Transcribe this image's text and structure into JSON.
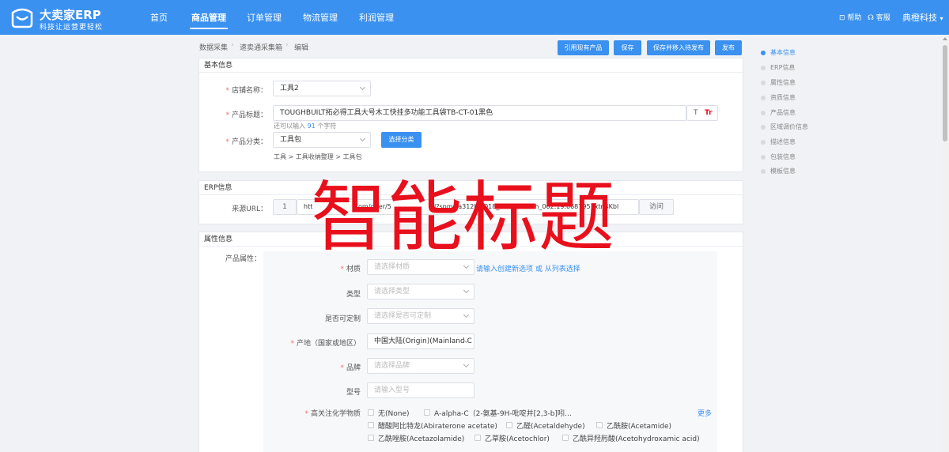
{
  "header": {
    "logo_title": "大卖家ERP",
    "logo_sub": "科技让运营更轻松",
    "nav": [
      "首页",
      "商品管理",
      "订单管理",
      "物流管理",
      "利润管理"
    ],
    "help": "帮助",
    "service": "客服",
    "company": "典橙科技"
  },
  "breadcrumb": [
    "数据采集",
    "速卖通采集箱",
    "编辑"
  ],
  "toolbar": [
    "引用现有产品",
    "保存",
    "保存并移入待发布",
    "发布"
  ],
  "basic": {
    "title": "基本信息",
    "shop_label": "店铺名称：",
    "shop_value": "工具2",
    "title_label": "产品标题：",
    "title_value": "TOUGHBUILT拓必得工具大号木工快挂多功能工具袋TB-CT-01黑色",
    "remain_pre": "还可以输入",
    "remain_num": "91",
    "remain_suf": "个字符",
    "cat_label": "产品分类：",
    "cat_value": "工具包",
    "cat_button": "选择分类",
    "cat_path": "工具 > 工具收纳整理 > 工具包",
    "t_icon": "T",
    "tr_icon": "Tr"
  },
  "erp": {
    "title": "ERP信息",
    "url_label": "来源URL：",
    "url_num": "1",
    "url_text": "htt",
    "url_mid": "om/offer/5",
    "url_tail": "l?spm=a312h.2018_new_sem.dh_002.19.0687951xtn4Kbl",
    "visit": "访问"
  },
  "attr": {
    "title": "属性信息",
    "prop_label": "产品属性：",
    "material_label": "材质",
    "material_ph": "请选择材质",
    "material_link": "请输入创建新选项 或 从列表选择",
    "type_label": "类型",
    "type_ph": "请选择类型",
    "custom_label": "是否可定制",
    "custom_ph": "请选择是否可定制",
    "origin_label": "产地（国家或地区）",
    "origin_value": "中国大陆(Origin)(Mainland C",
    "brand_label": "品牌",
    "brand_ph": "请选择品牌",
    "model_label": "型号",
    "model_ph": "请输入型号",
    "chem_label": "高关注化学物质",
    "chem_more": "更多",
    "chem_items": [
      "无(None)",
      "A-alpha-C（2-氨基-9H-吡啶并[2,3-b]吲…",
      "醋酸阿比特龙(Abiraterone acetate)",
      "乙醛(Acetaldehyde)",
      "乙酰胺(Acetamide)",
      "乙酰唑胺(Acetazolamide)",
      "乙草胺(Acetochlor)",
      "乙酰异羟肟酸(Acetohydroxamic acid)"
    ]
  },
  "anchors": [
    "基本信息",
    "ERP信息",
    "属性信息",
    "资质信息",
    "产品信息",
    "区域调价信息",
    "描述信息",
    "包装信息",
    "模板信息"
  ],
  "overlay": "智能标题",
  "colors": {
    "primary": "#3a91f0",
    "required": "#f56c6c",
    "overlay": "#e8101c"
  }
}
